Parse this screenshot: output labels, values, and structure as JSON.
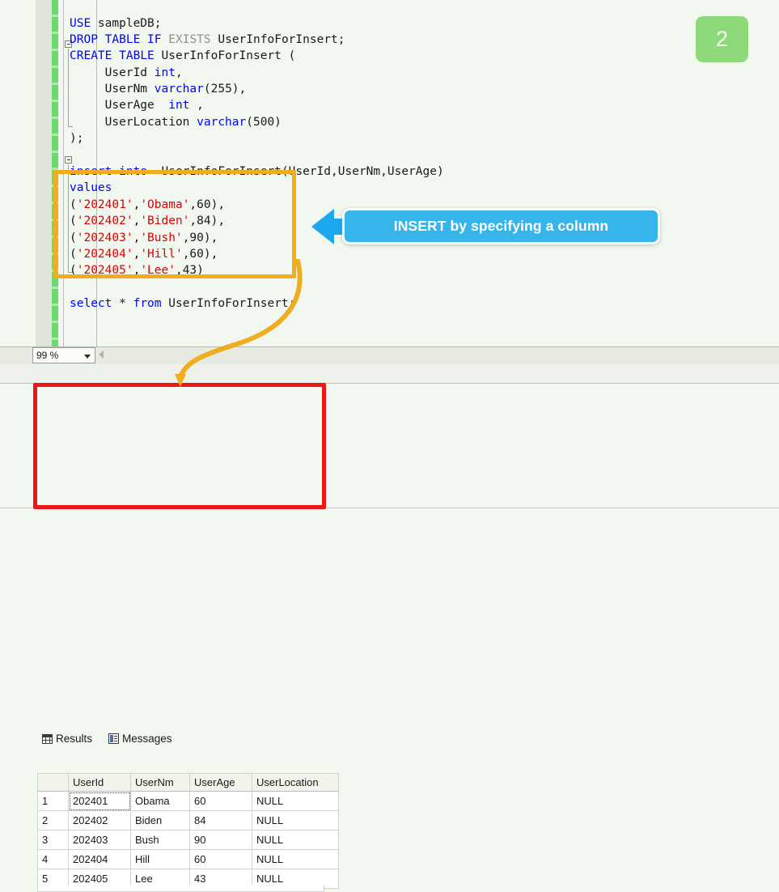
{
  "editor": {
    "code_lines": [
      {
        "indent": 0,
        "tokens": [
          {
            "text": "USE",
            "cls": "kw"
          },
          {
            "text": " sampleDB;",
            "cls": "id"
          }
        ]
      },
      {
        "indent": 0,
        "tokens": [
          {
            "text": "DROP",
            "cls": "kw"
          },
          {
            "text": " ",
            "cls": "id"
          },
          {
            "text": "TABLE",
            "cls": "kw"
          },
          {
            "text": " ",
            "cls": "id"
          },
          {
            "text": "IF",
            "cls": "kw"
          },
          {
            "text": " ",
            "cls": "id"
          },
          {
            "text": "EXISTS",
            "cls": "gray"
          },
          {
            "text": " UserInfoForInsert;",
            "cls": "id"
          }
        ]
      },
      {
        "indent": 0,
        "tokens": [
          {
            "text": "CREATE",
            "cls": "kw"
          },
          {
            "text": " ",
            "cls": "id"
          },
          {
            "text": "TABLE",
            "cls": "kw"
          },
          {
            "text": " UserInfoForInsert (",
            "cls": "id"
          }
        ]
      },
      {
        "indent": 0,
        "tokens": [
          {
            "text": "     UserId ",
            "cls": "id"
          },
          {
            "text": "int",
            "cls": "typ"
          },
          {
            "text": ",",
            "cls": "id"
          }
        ]
      },
      {
        "indent": 0,
        "tokens": [
          {
            "text": "     UserNm ",
            "cls": "id"
          },
          {
            "text": "varchar",
            "cls": "typ"
          },
          {
            "text": "(255),",
            "cls": "id"
          }
        ]
      },
      {
        "indent": 0,
        "tokens": [
          {
            "text": "     UserAge  ",
            "cls": "id"
          },
          {
            "text": "int",
            "cls": "typ"
          },
          {
            "text": " ,",
            "cls": "id"
          }
        ]
      },
      {
        "indent": 0,
        "tokens": [
          {
            "text": "     UserLocation ",
            "cls": "id"
          },
          {
            "text": "varchar",
            "cls": "typ"
          },
          {
            "text": "(500)",
            "cls": "id"
          }
        ]
      },
      {
        "indent": 0,
        "tokens": [
          {
            "text": ");",
            "cls": "id"
          }
        ]
      },
      {
        "indent": 0,
        "tokens": [
          {
            "text": "",
            "cls": "id"
          }
        ]
      },
      {
        "indent": 0,
        "tokens": [
          {
            "text": "insert",
            "cls": "kw"
          },
          {
            "text": " ",
            "cls": "id"
          },
          {
            "text": "into",
            "cls": "kw"
          },
          {
            "text": "  UserInfoForInsert(UserId,UserNm,UserAge)",
            "cls": "id"
          }
        ]
      },
      {
        "indent": 0,
        "tokens": [
          {
            "text": "values",
            "cls": "kw"
          }
        ]
      },
      {
        "indent": 0,
        "tokens": [
          {
            "text": "(",
            "cls": "id"
          },
          {
            "text": "'202401'",
            "cls": "str"
          },
          {
            "text": ",",
            "cls": "id"
          },
          {
            "text": "'Obama'",
            "cls": "str"
          },
          {
            "text": ",60),",
            "cls": "id"
          }
        ]
      },
      {
        "indent": 0,
        "tokens": [
          {
            "text": "(",
            "cls": "id"
          },
          {
            "text": "'202402'",
            "cls": "str"
          },
          {
            "text": ",",
            "cls": "id"
          },
          {
            "text": "'Biden'",
            "cls": "str"
          },
          {
            "text": ",84),",
            "cls": "id"
          }
        ]
      },
      {
        "indent": 0,
        "tokens": [
          {
            "text": "(",
            "cls": "id"
          },
          {
            "text": "'202403'",
            "cls": "str"
          },
          {
            "text": ",",
            "cls": "id"
          },
          {
            "text": "'Bush'",
            "cls": "str"
          },
          {
            "text": ",90),",
            "cls": "id"
          }
        ]
      },
      {
        "indent": 0,
        "tokens": [
          {
            "text": "(",
            "cls": "id"
          },
          {
            "text": "'202404'",
            "cls": "str"
          },
          {
            "text": ",",
            "cls": "id"
          },
          {
            "text": "'Hill'",
            "cls": "str"
          },
          {
            "text": ",60),",
            "cls": "id"
          }
        ]
      },
      {
        "indent": 0,
        "tokens": [
          {
            "text": "(",
            "cls": "id"
          },
          {
            "text": "'202405'",
            "cls": "str"
          },
          {
            "text": ",",
            "cls": "id"
          },
          {
            "text": "'Lee'",
            "cls": "str"
          },
          {
            "text": ",43)",
            "cls": "id"
          }
        ]
      },
      {
        "indent": 0,
        "tokens": [
          {
            "text": "",
            "cls": "id"
          }
        ]
      },
      {
        "indent": 0,
        "tokens": [
          {
            "text": "select",
            "cls": "kw"
          },
          {
            "text": " * ",
            "cls": "id"
          },
          {
            "text": "from",
            "cls": "kw"
          },
          {
            "text": " UserInfoForInsert;",
            "cls": "id"
          }
        ]
      }
    ]
  },
  "zoom_control": {
    "value": "99 %",
    "caret_icon": "chevron-down-icon"
  },
  "tabs": [
    {
      "label": "Results",
      "icon": "grid-icon",
      "selected": true
    },
    {
      "label": "Messages",
      "icon": "message-icon",
      "selected": false
    }
  ],
  "results": {
    "columns": [
      "",
      "UserId",
      "UserNm",
      "UserAge",
      "UserLocation"
    ],
    "rows": [
      {
        "num": "1",
        "UserId": "202401",
        "UserNm": "Obama",
        "UserAge": "60",
        "UserLocation": "NULL"
      },
      {
        "num": "2",
        "UserId": "202402",
        "UserNm": "Biden",
        "UserAge": "84",
        "UserLocation": "NULL"
      },
      {
        "num": "3",
        "UserId": "202403",
        "UserNm": "Bush",
        "UserAge": "90",
        "UserLocation": "NULL"
      },
      {
        "num": "4",
        "UserId": "202404",
        "UserNm": "Hill",
        "UserAge": "60",
        "UserLocation": "NULL"
      },
      {
        "num": "5",
        "UserId": "202405",
        "UserNm": "Lee",
        "UserAge": "43",
        "UserLocation": "NULL"
      }
    ]
  },
  "annotations": {
    "callout_label": "INSERT by specifying a column",
    "step_number": "2",
    "values_box_color": "#f0ad1f",
    "results_box_color": "#ef1616",
    "callout_color": "#35b5ea",
    "step_badge_color": "#8ed97a",
    "arrow_color": "#1ca8ee",
    "curve_color": "#f0ad1f"
  }
}
